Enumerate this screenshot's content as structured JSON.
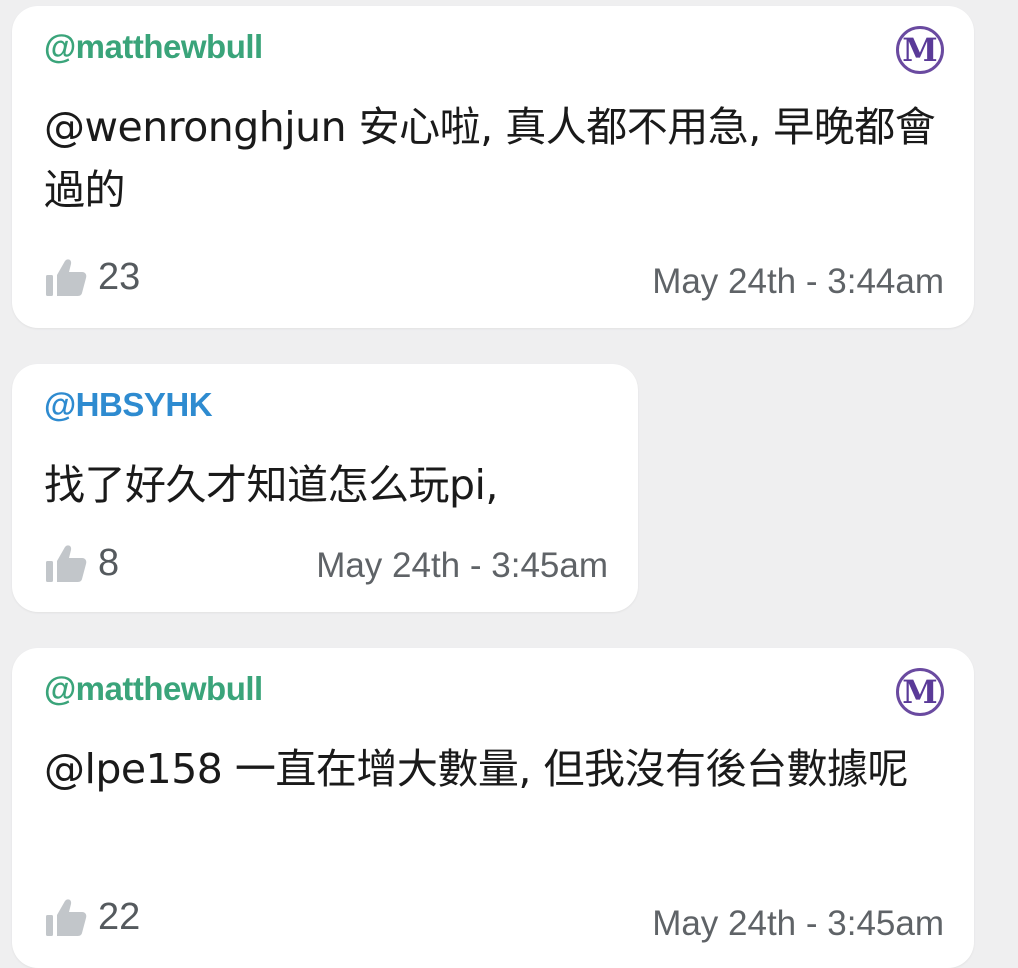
{
  "colors": {
    "background": "#efeff0",
    "username_green": "#3aa47a",
    "username_blue": "#2e8bd0",
    "mod_badge": "#5a3a98",
    "meta_text": "#5f6367"
  },
  "comments": [
    {
      "username": "@matthewbull",
      "badge": "M",
      "message": "@wenronghjun 安心啦, 真人都不用急, 早晚都會過的",
      "likes": "23",
      "timestamp": "May 24th - 3:44am"
    },
    {
      "username": "@HBSYHK",
      "message": "找了好久才知道怎么玩pi,",
      "likes": "8",
      "timestamp": "May 24th - 3:45am"
    },
    {
      "username": "@matthewbull",
      "badge": "M",
      "message": "@lpe158 一直在增大數量, 但我沒有後台數據呢",
      "likes": "22",
      "timestamp": "May 24th - 3:45am"
    }
  ]
}
